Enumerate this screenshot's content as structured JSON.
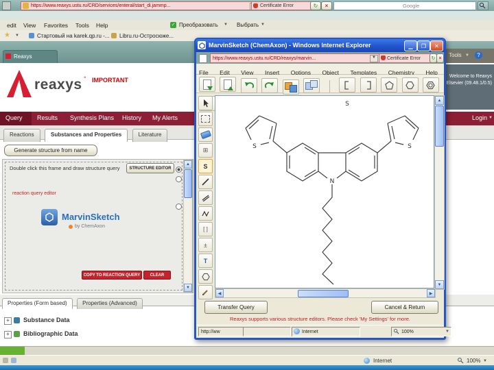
{
  "browser": {
    "url": "https://www.reaxys.ustu.ru/CRD/services/enteral/start_di.jammp...",
    "certificate_error": "Certificate Error",
    "search_placeholder": "Google",
    "menu": [
      "edit",
      "View",
      "Favorites",
      "Tools",
      "Help"
    ],
    "convert_button": "Преобразовать",
    "select_button": "Выбрать",
    "favorites": [
      "Стартовый на karek.qp.ru -...",
      "Libru.ru-Остросюже..."
    ],
    "tab_label": "Reaxys",
    "tools_label": "Tools",
    "status_zone": "Internet",
    "status_zoom": "100%"
  },
  "page": {
    "brand": "reaxys",
    "important_label": "IMPORTANT",
    "welcome_line1": "Welcome to Reaxys",
    "welcome_line2": "Elsevier (09.48.1/0.5)",
    "nav_tabs": [
      "Query",
      "Results",
      "Synthesis Plans",
      "History",
      "My Alerts"
    ],
    "login_label": "Login",
    "sub_tabs": [
      "Reactions",
      "Substances and Properties",
      "Literature"
    ],
    "generate_button": "Generate structure from name",
    "frame_hint": "Double click this frame and draw structure query",
    "structure_editor_button": "STRUCTURE EDITOR",
    "editor_note": "reaction query editor",
    "marvin_name": "MarvinSketch",
    "marvin_by": "by ChemAxon",
    "copy_button": "COPY TO REACTION QUERY",
    "clear_button": "CLEAR",
    "properties_tabs": [
      "Properties (Form based)",
      "Properties (Advanced)"
    ],
    "sections": [
      "Substance Data",
      "Bibliographic Data"
    ]
  },
  "popup": {
    "title": "MarvinSketch (ChemAxon) - Windows Internet Explorer",
    "url": "https://www.reaxys.ustu.ru/CRD/reaxys/marvin...",
    "certificate_error": "Certificate Error",
    "menu": [
      "File",
      "Edit",
      "View",
      "Insert",
      "Options",
      "Object",
      "Templates",
      "Chemistry",
      "Help"
    ],
    "tools": {
      "atom_s": "S",
      "text_tool": "T"
    },
    "atoms": {
      "n": "N",
      "s": "S"
    },
    "transfer_button": "Transfer Query",
    "cancel_button": "Cancel & Return",
    "note": "Reaxys supports various structure editors. Please check 'My Settings' for more.",
    "status_url": "http://ww",
    "status_zone": "Internet",
    "status_zoom": "100%"
  }
}
